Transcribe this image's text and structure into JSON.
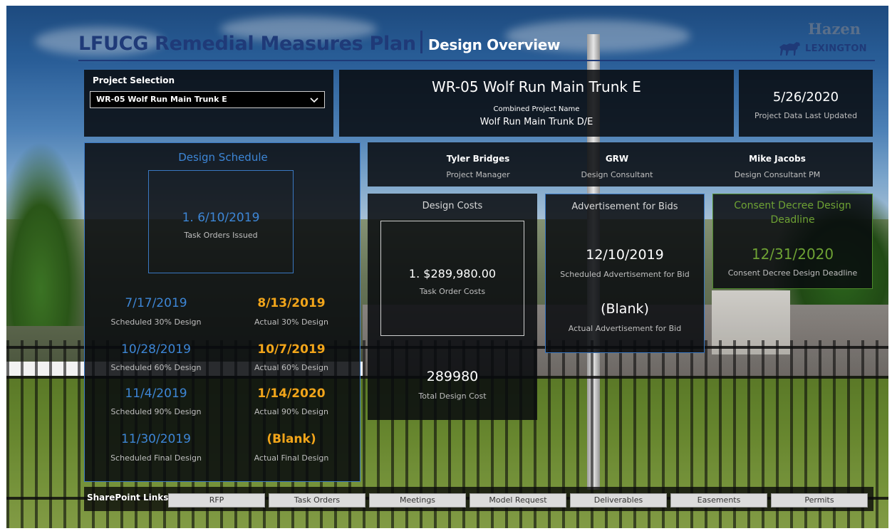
{
  "header": {
    "title": "LFUCG Remedial Measures Plan",
    "subtitle": "Design Overview",
    "logo_hazen": "Hazen",
    "logo_lexington": "LEXINGTON"
  },
  "project_selection": {
    "label": "Project Selection",
    "selected": "WR-05 Wolf Run Main Trunk E"
  },
  "project_card": {
    "name": "WR-05 Wolf Run Main Trunk E",
    "combined_label": "Combined Project Name",
    "combined_value": "Wolf Run Main Trunk D/E"
  },
  "updated_card": {
    "date": "5/26/2020",
    "label": "Project Data Last Updated"
  },
  "design_schedule": {
    "title": "Design Schedule",
    "task_orders": {
      "value": "1. 6/10/2019",
      "label": "Task Orders Issued"
    },
    "rows": [
      {
        "scheduled": "7/17/2019",
        "scheduled_label": "Scheduled 30% Design",
        "actual": "8/13/2019",
        "actual_label": "Actual 30% Design"
      },
      {
        "scheduled": "10/28/2019",
        "scheduled_label": "Scheduled 60% Design",
        "actual": "10/7/2019",
        "actual_label": "Actual 60% Design"
      },
      {
        "scheduled": "11/4/2019",
        "scheduled_label": "Scheduled 90% Design",
        "actual": "1/14/2020",
        "actual_label": "Actual 90% Design"
      },
      {
        "scheduled": "11/30/2019",
        "scheduled_label": "Scheduled Final Design",
        "actual": "(Blank)",
        "actual_label": "Actual Final Design"
      }
    ]
  },
  "people": [
    {
      "name": "Tyler Bridges",
      "role": "Project Manager"
    },
    {
      "name": "GRW",
      "role": "Design Consultant"
    },
    {
      "name": "Mike Jacobs",
      "role": "Design Consultant PM"
    }
  ],
  "design_costs": {
    "title": "Design Costs",
    "task_order_value": "1. $289,980.00",
    "task_order_label": "Task Order Costs",
    "total_value": "289980",
    "total_label": "Total Design Cost"
  },
  "advertisement": {
    "title": "Advertisement for Bids",
    "scheduled_value": "12/10/2019",
    "scheduled_label": "Scheduled Advertisement for Bid",
    "actual_value": "(Blank)",
    "actual_label": "Actual Advertisement for Bid"
  },
  "consent": {
    "title_line1": "Consent Decree Design",
    "title_line2": "Deadline",
    "value": "12/31/2020",
    "label": "Consent Decree Design Deadline"
  },
  "sharepoint": {
    "label": "SharePoint Links",
    "links": [
      "RFP",
      "Task Orders",
      "Meetings",
      "Model Request",
      "Deliverables",
      "Easements",
      "Permits"
    ]
  },
  "colors": {
    "title_blue": "#1f3a78",
    "accent_blue": "#3d86d6",
    "accent_orange": "#f2a51a",
    "accent_green": "#6ea234"
  }
}
